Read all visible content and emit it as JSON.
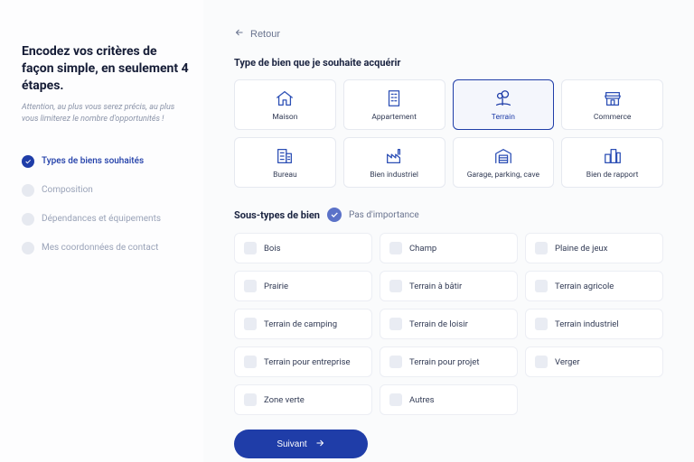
{
  "sidebar": {
    "title": "Encodez vos critères de façon simple, en seulement 4 étapes.",
    "hint": "Attention, au plus vous serez précis, au plus vous limiterez le nombre d'opportunités !",
    "steps": [
      {
        "label": "Types de biens souhaités",
        "active": true
      },
      {
        "label": "Composition",
        "active": false
      },
      {
        "label": "Dépendances et équipements",
        "active": false
      },
      {
        "label": "Mes coordonnées de contact",
        "active": false
      }
    ]
  },
  "back_label": "Retour",
  "type_section_title": "Type de bien que je souhaite acquérir",
  "property_types": [
    {
      "label": "Maison",
      "icon": "house",
      "selected": false
    },
    {
      "label": "Appartement",
      "icon": "apartment",
      "selected": false
    },
    {
      "label": "Terrain",
      "icon": "terrain",
      "selected": true
    },
    {
      "label": "Commerce",
      "icon": "commerce",
      "selected": false
    },
    {
      "label": "Bureau",
      "icon": "office",
      "selected": false
    },
    {
      "label": "Bien industriel",
      "icon": "industrial",
      "selected": false
    },
    {
      "label": "Garage, parking, cave",
      "icon": "garage",
      "selected": false
    },
    {
      "label": "Bien de rapport",
      "icon": "investment",
      "selected": false
    }
  ],
  "subtype_title": "Sous-types de bien",
  "no_importance_label": "Pas d'importance",
  "no_importance_checked": true,
  "subtypes": [
    "Bois",
    "Champ",
    "Plaine de jeux",
    "Prairie",
    "Terrain à bâtir",
    "Terrain agricole",
    "Terrain de camping",
    "Terrain de loisir",
    "Terrain industriel",
    "Terrain pour entreprise",
    "Terrain pour projet",
    "Verger",
    "Zone verte",
    "Autres"
  ],
  "next_label": "Suivant",
  "colors": {
    "primary": "#1f3da8",
    "muted": "#8a93a8",
    "border": "#e6e9f0"
  }
}
